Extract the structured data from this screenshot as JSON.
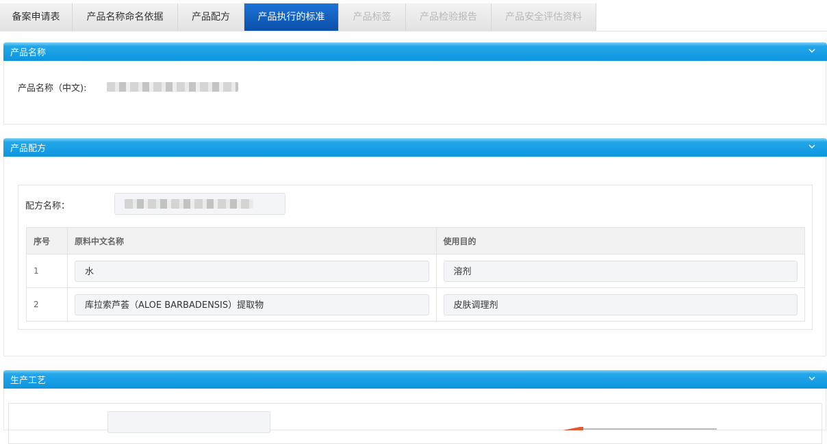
{
  "tabs": [
    {
      "label": "备案申请表",
      "state": "normal"
    },
    {
      "label": "产品名称命名依据",
      "state": "normal"
    },
    {
      "label": "产品配方",
      "state": "normal"
    },
    {
      "label": "产品执行的标准",
      "state": "active"
    },
    {
      "label": "产品标签",
      "state": "disabled"
    },
    {
      "label": "产品检验报告",
      "state": "disabled"
    },
    {
      "label": "产品安全评估资料",
      "state": "disabled"
    }
  ],
  "sections": {
    "product_name": {
      "title": "产品名称",
      "cn_name_label": "产品名称（中文):"
    },
    "formula": {
      "title": "产品配方",
      "formula_name_label": "配方名称：",
      "table": {
        "headers": [
          "序号",
          "原料中文名称",
          "使用目的"
        ],
        "rows": [
          {
            "index": "1",
            "ingredient": "水",
            "purpose": "溶剂"
          },
          {
            "index": "2",
            "ingredient": "库拉索芦荟（ALOE BARBADENSIS）提取物",
            "purpose": "皮肤调理剂"
          }
        ]
      }
    },
    "process": {
      "title": "生产工艺"
    }
  },
  "icons": {
    "collapse": "chevron-down-icon"
  },
  "colors": {
    "panel_header": "#1a9fe4",
    "active_tab": "#0a59bf",
    "tab_bg": "#e9e9e9"
  }
}
